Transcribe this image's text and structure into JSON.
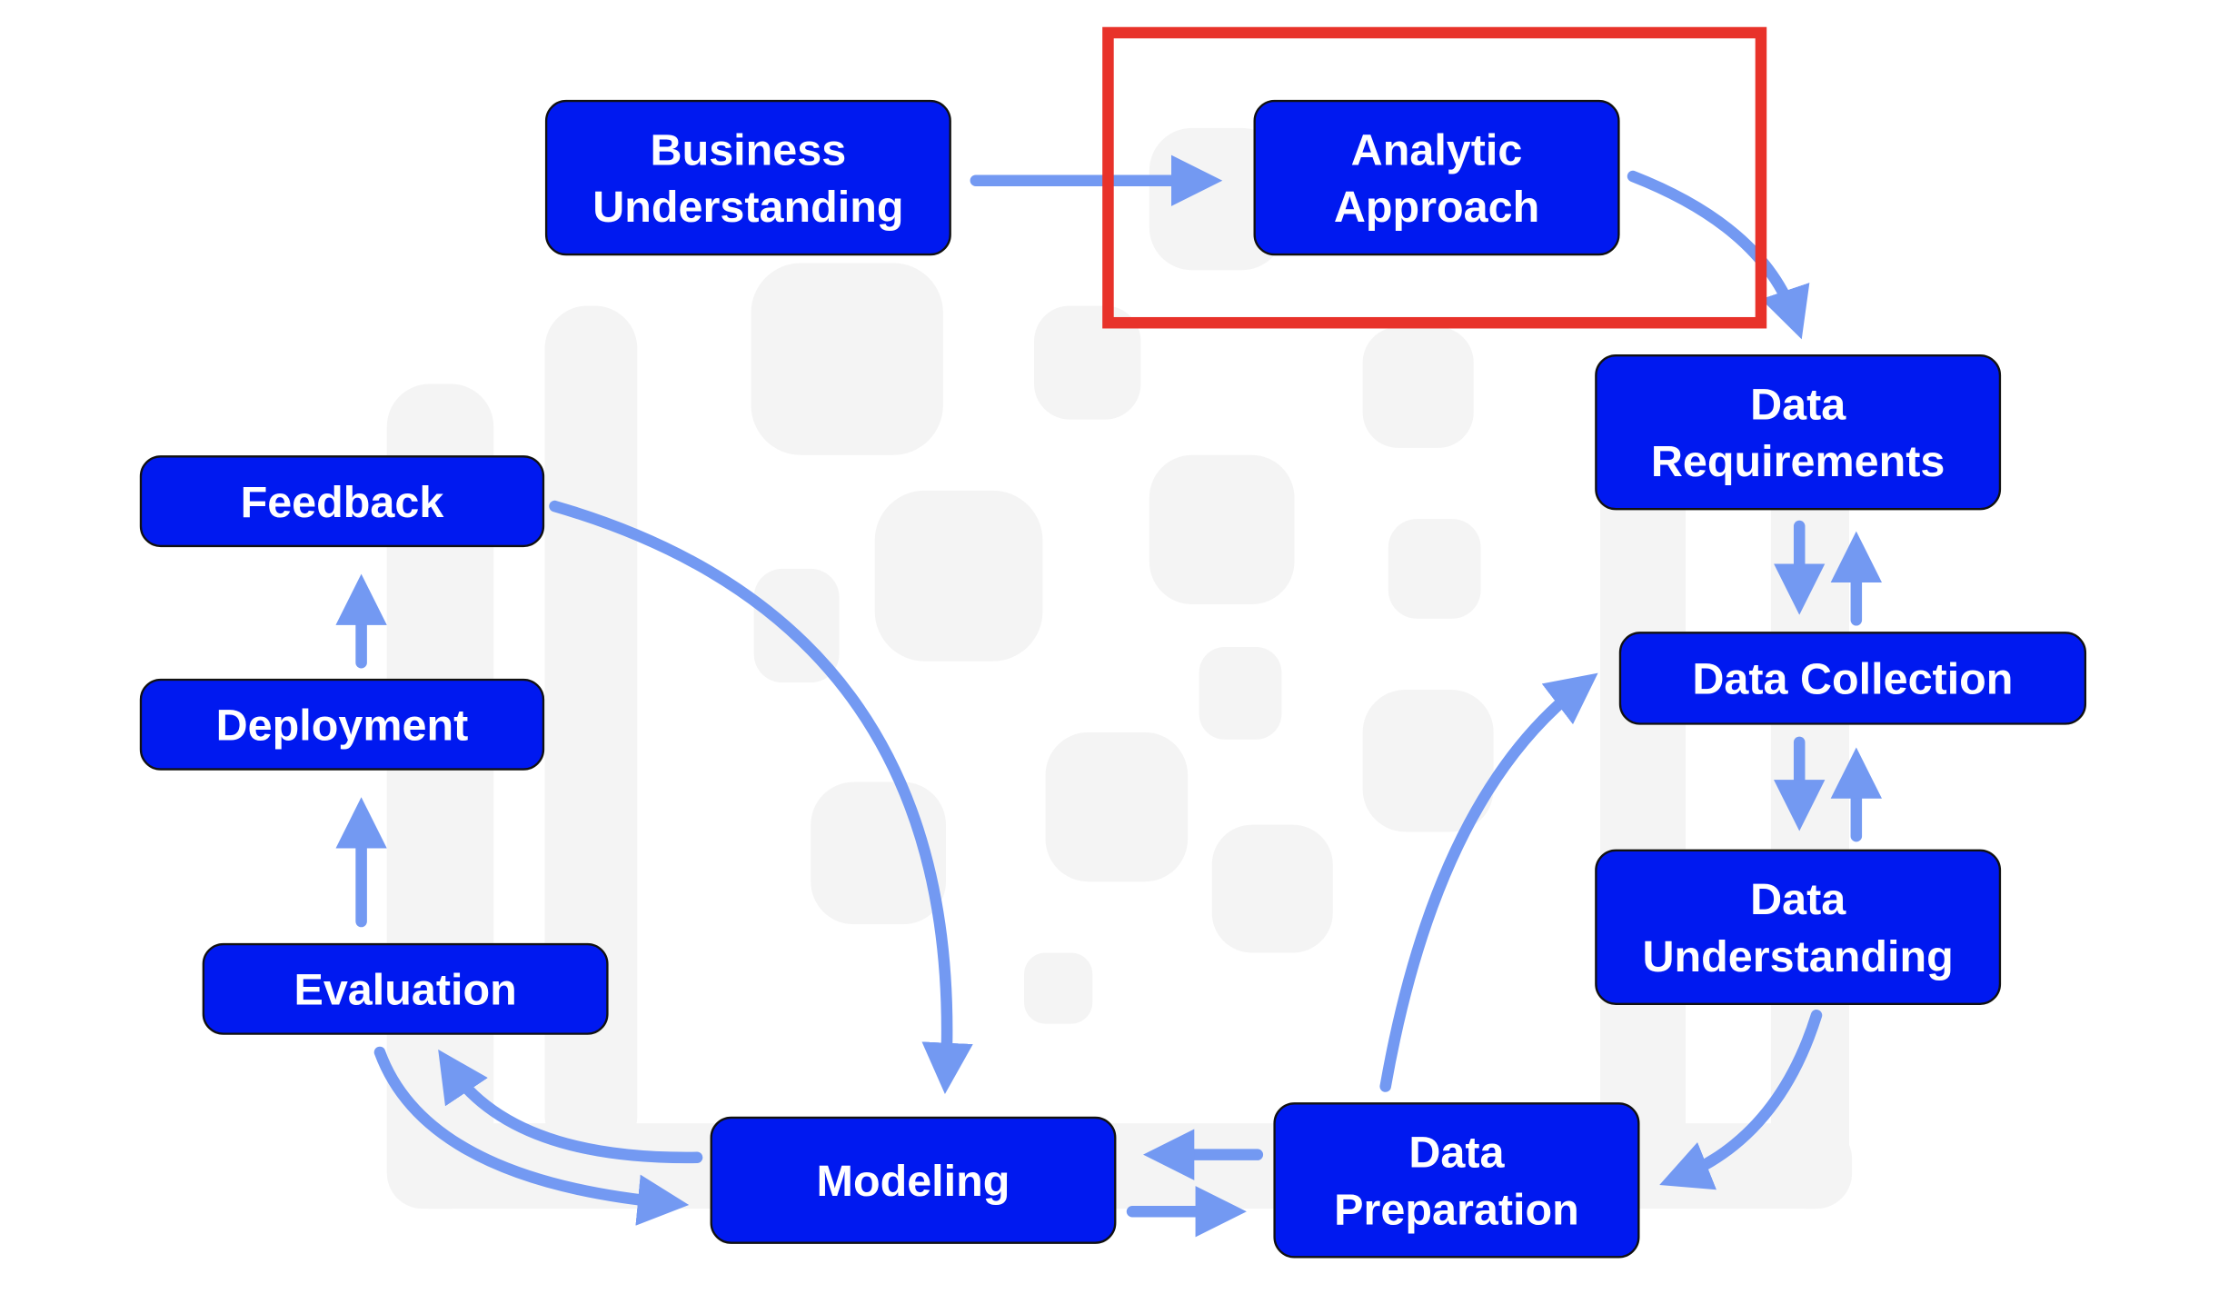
{
  "colors": {
    "node_fill": "#0019F0",
    "arrow": "#7399F2",
    "highlight": "#E8322A",
    "background_shapes": "#F4F4F4"
  },
  "nodes": [
    {
      "id": "business-understanding",
      "lines": [
        "Business",
        "Understanding"
      ]
    },
    {
      "id": "analytic-approach",
      "lines": [
        "Analytic",
        "Approach"
      ]
    },
    {
      "id": "data-requirements",
      "lines": [
        "Data",
        "Requirements"
      ]
    },
    {
      "id": "data-collection",
      "lines": [
        "Data Collection"
      ]
    },
    {
      "id": "data-understanding",
      "lines": [
        "Data",
        "Understanding"
      ]
    },
    {
      "id": "data-preparation",
      "lines": [
        "Data",
        "Preparation"
      ]
    },
    {
      "id": "modeling",
      "lines": [
        "Modeling"
      ]
    },
    {
      "id": "evaluation",
      "lines": [
        "Evaluation"
      ]
    },
    {
      "id": "deployment",
      "lines": [
        "Deployment"
      ]
    },
    {
      "id": "feedback",
      "lines": [
        "Feedback"
      ]
    }
  ],
  "highlighted_node": "analytic-approach"
}
